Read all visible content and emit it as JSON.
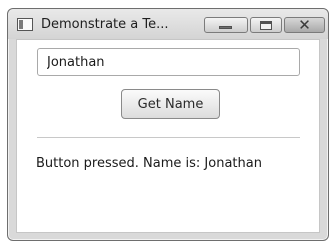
{
  "window": {
    "title": "Demonstrate a Te...",
    "controls": {
      "minimize_icon": "minimize-icon",
      "maximize_icon": "maximize-icon",
      "close_icon": "close-icon",
      "close_glyph": "✕"
    }
  },
  "form": {
    "name_value": "Jonathan",
    "button_label": "Get Name",
    "status_text": "Button pressed. Name is: Jonathan"
  }
}
